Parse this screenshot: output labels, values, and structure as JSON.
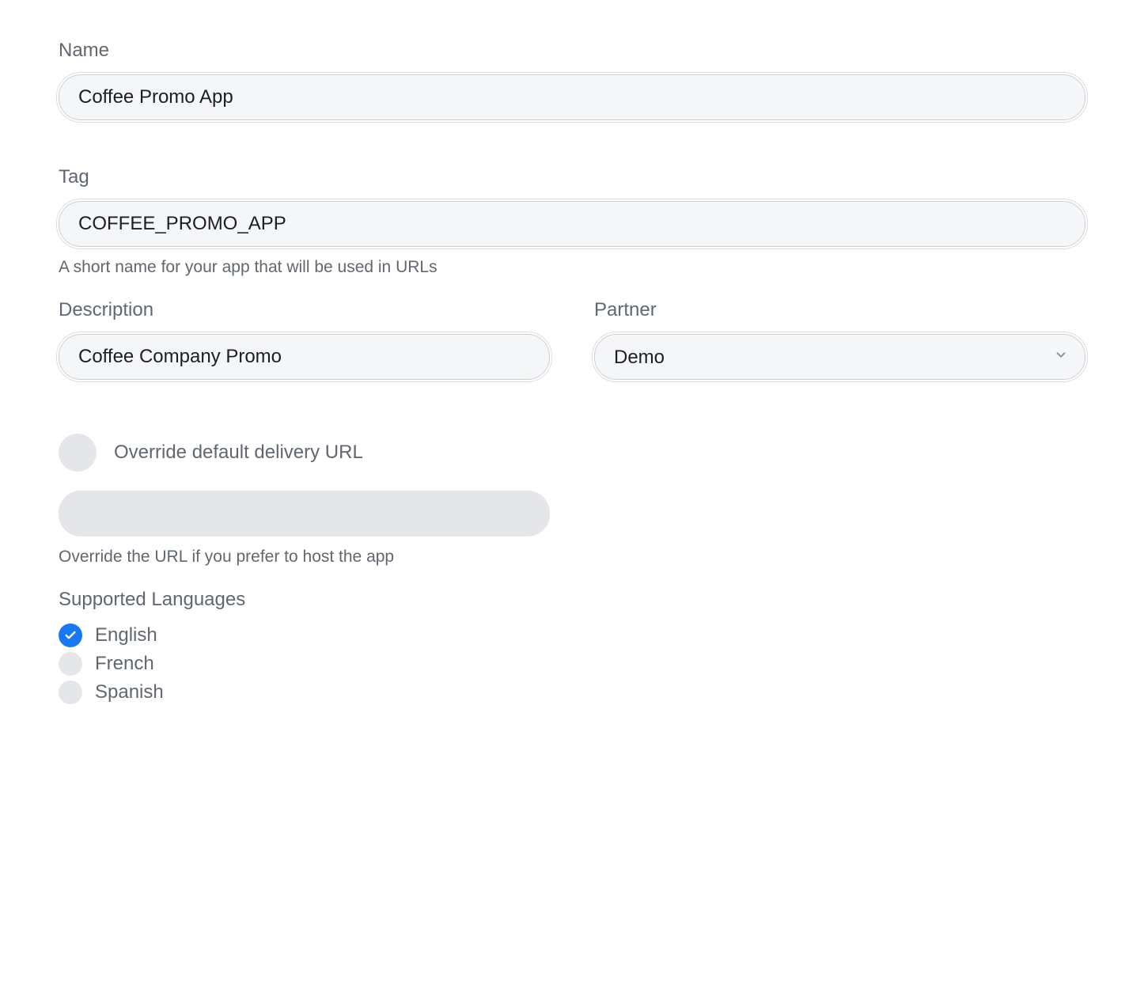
{
  "form": {
    "name": {
      "label": "Name",
      "value": "Coffee Promo App"
    },
    "tag": {
      "label": "Tag",
      "value": "COFFEE_PROMO_APP",
      "help": "A short name for your app that will be used in URLs"
    },
    "description": {
      "label": "Description",
      "value": "Coffee Company Promo"
    },
    "partner": {
      "label": "Partner",
      "value": "Demo"
    },
    "override": {
      "toggle_label": "Override default delivery URL",
      "checked": false,
      "value": "",
      "help": "Override the URL if you prefer to host the app"
    },
    "languages": {
      "label": "Supported Languages",
      "items": [
        {
          "label": "English",
          "checked": true
        },
        {
          "label": "French",
          "checked": false
        },
        {
          "label": "Spanish",
          "checked": false
        }
      ]
    }
  }
}
